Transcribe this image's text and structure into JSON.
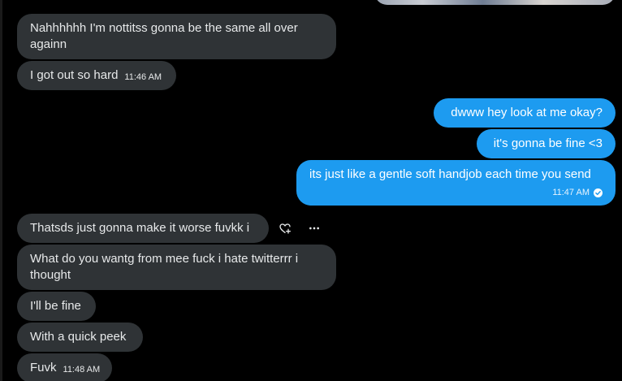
{
  "messages": [
    {
      "side": "in",
      "text": "Nahhhhhh I'm nottitss gonna be the same all over againn",
      "time": ""
    },
    {
      "side": "in",
      "text": "I got out so hard",
      "time": "11:46 AM"
    },
    {
      "side": "out",
      "text": "dwww hey look at me okay?",
      "time": ""
    },
    {
      "side": "out",
      "text": "it's gonna be fine <3",
      "time": ""
    },
    {
      "side": "out",
      "text": "its just like a gentle soft handjob each time you send",
      "time": "11:47 AM"
    },
    {
      "side": "in",
      "text": "Thatsds just gonna make it worse fuvkk i",
      "time": ""
    },
    {
      "side": "in",
      "text": "What do you wantg from mee fuck i hate twitterrr i thought",
      "time": ""
    },
    {
      "side": "in",
      "text": "I'll be fine",
      "time": ""
    },
    {
      "side": "in",
      "text": "With a quick peek",
      "time": ""
    },
    {
      "side": "in",
      "text": "Fuvk",
      "time": "11:48 AM"
    }
  ],
  "icons": {
    "react": "heart-plus-icon",
    "more": "more-horizontal-icon",
    "sent": "check-circle-icon"
  },
  "colors": {
    "background": "#000000",
    "incoming_bubble": "#2f3336",
    "outgoing_bubble": "#1d9bf0",
    "text": "#e7e9ea"
  }
}
